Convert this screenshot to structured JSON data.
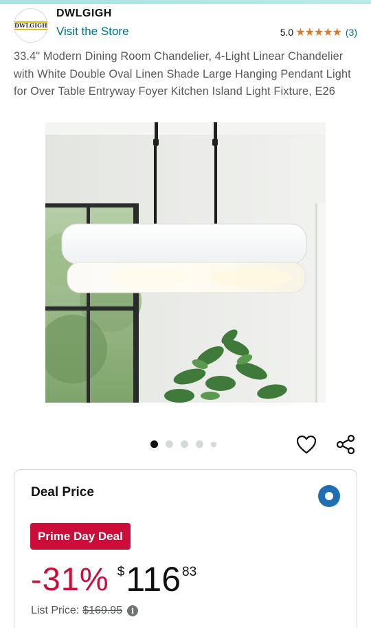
{
  "brand": {
    "logo_text": "DWLGIGH",
    "name": "DWLGIGH",
    "visit_store": "Visit the Store",
    "rating_value": "5.0",
    "stars": "★★★★★",
    "rating_count": "(3)"
  },
  "product": {
    "title": "33.4\" Modern Dining Room Chandelier, 4-Light Linear Chandelier with White Double Oval Linen Shade Large Hanging Pendant Light for Over Table Entryway Foyer Kitchen Island Light Fixture, E26",
    "image_count": 5,
    "active_image": 1
  },
  "icons": {
    "favorite": "heart-icon",
    "share": "share-icon",
    "info": "info-icon"
  },
  "deal": {
    "label": "Deal Price",
    "badge": "Prime Day Deal",
    "discount": "-31%",
    "currency": "$",
    "price_whole": "116",
    "price_fraction": "83",
    "list_price_label": "List Price:",
    "list_price": "$169.95",
    "info_glyph": "i"
  },
  "colors": {
    "link": "#007185",
    "star": "#de7921",
    "deal_red": "#cc0c39",
    "radio_blue": "#1f6fb2"
  }
}
